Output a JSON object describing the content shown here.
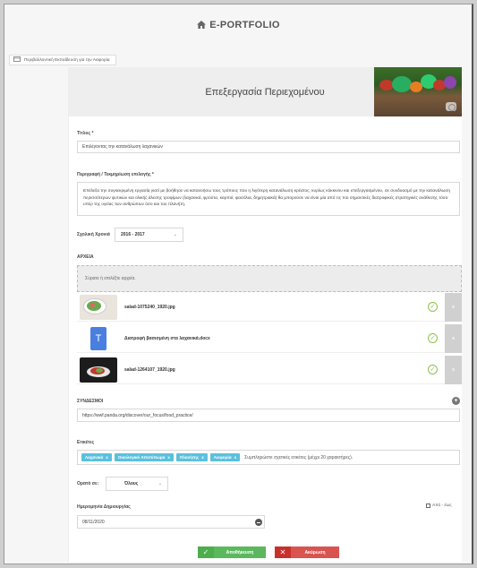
{
  "app": {
    "brand": "E-PORTFOLIO"
  },
  "breadcrumb": {
    "label": "Περιβαλλοντική Εκπαίδευση για την Αειφορία"
  },
  "page": {
    "title": "Επεξεργασία Περιεχομένου"
  },
  "form": {
    "title_label": "Τίτλος *",
    "title_value": "Επιλέγοντας την κατανάλωση λαχανικών",
    "description_label": "Περιγραφή / Τεκμηρίωση επιλογής *",
    "description_value": "Επέλεξα την συγκεκριμένη εργασία γιατί με βοήθησε να κατανοήσω τους τρόπους που η λιγότερη κατανάλωση κρέατος, κυρίως κόκκινου και επεξεργασμένου, σε συνδυασμό με την κατανάλωση περισσότερων φυτικών και ολικής άλεσης τροφίμων (λαχανικά, φρούτα, καρποί, φασόλια, δημητριακά) θα μπορούσε να είναι μία από τις πιο σημαντικές διατροφικές στρατηγικές ανάθεσης τόσο υπέρ της υγείας των ανθρώπων όσο και του πλανήτη.",
    "year_label": "Σχολική Χρονιά",
    "year_value": "2016 - 2017",
    "files_label": "ΑΡΧΕΙΑ",
    "dropzone_text": "Σύρατε ή επιλέξτε αρχεία.",
    "files": [
      {
        "name": "salad-1075240_1920.jpg"
      },
      {
        "name": "Διατροφή βασισμένη στα λαχανικά.docx"
      },
      {
        "name": "salad-1264107_1920.jpg"
      }
    ],
    "links_label": "ΣΥΝΔΕΣΜΟΙ",
    "link_value": "https://wwf.panda.org/discover/our_focus/food_practice/",
    "tags_label": "Ετικέτες",
    "tags": [
      {
        "label": "Λαχανικά",
        "x": "x"
      },
      {
        "label": "Οικολογικό Αποτύπωμα",
        "x": "x"
      },
      {
        "label": "Πλανήτης",
        "x": "x"
      },
      {
        "label": "Αειφορία",
        "x": "x"
      }
    ],
    "tags_placeholder": "Συμπληρώστε σχετικές ετικέτες (μέχρι 20 χαρακτήρες).",
    "visible_label": "Ορατό σε:",
    "visible_value": "Όλους",
    "created_label": "Ημερομηνία Δημιουργίας",
    "created_value": "08/11/2020",
    "range_label": "Από - έως"
  },
  "actions": {
    "save": "Αποθήκευση",
    "cancel": "Ακύρωση"
  },
  "colors": {
    "save": "#5cb85c",
    "cancel": "#d9534f",
    "tag": "#5bc0de",
    "check": "#8bc34a"
  }
}
